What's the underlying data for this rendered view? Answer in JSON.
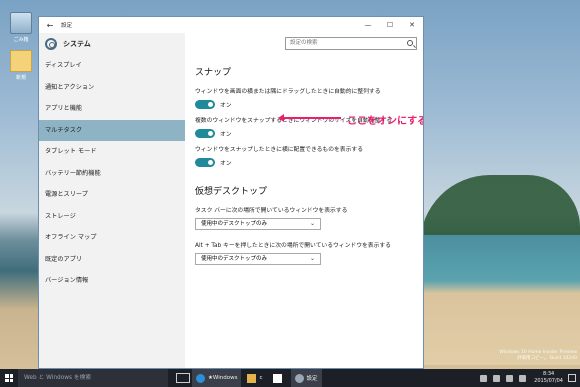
{
  "desktop": {
    "icons": [
      {
        "label": "ごみ箱"
      },
      {
        "label": "新規"
      }
    ],
    "watermark_lines": [
      "Windows 10 Home Insider Preview",
      "評価用コピー。 Build 10240"
    ]
  },
  "window": {
    "back_glyph": "←",
    "title": "設定",
    "controls": {
      "minimize": "—",
      "maximize": "☐",
      "close": "✕"
    }
  },
  "sidebar": {
    "title": "システム",
    "items": [
      {
        "label": "ディスプレイ"
      },
      {
        "label": "通知とアクション"
      },
      {
        "label": "アプリと機能"
      },
      {
        "label": "マルチタスク",
        "active": true
      },
      {
        "label": "タブレット モード"
      },
      {
        "label": "バッテリー節約機能"
      },
      {
        "label": "電源とスリープ"
      },
      {
        "label": "ストレージ"
      },
      {
        "label": "オフライン マップ"
      },
      {
        "label": "既定のアプリ"
      },
      {
        "label": "バージョン情報"
      }
    ]
  },
  "search": {
    "placeholder": "設定の検索"
  },
  "snap": {
    "heading": "スナップ",
    "settings": [
      {
        "label": "ウィンドウを画面の横または隅にドラッグしたときに自動的に整列する",
        "toggle": "オン"
      },
      {
        "label": "複数のウィンドウをスナップするときにウィンドウのサイズを自動調整する",
        "toggle": "オン"
      },
      {
        "label": "ウィンドウをスナップしたときに横に配置できるものを表示する",
        "toggle": "オン"
      }
    ]
  },
  "virtual_desktops": {
    "heading": "仮想デスクトップ",
    "settings": [
      {
        "label": "タスク バーに次の場所で開いているウィンドウを表示する",
        "value": "使用中のデスクトップのみ"
      },
      {
        "label": "Alt + Tab キーを押したときに次の場所で開いているウィンドウを表示する",
        "value": "使用中のデスクトップのみ"
      }
    ]
  },
  "annotation": {
    "text": "ここをオンにする",
    "color": "#e8216f"
  },
  "taskbar": {
    "search_placeholder": "Web と Windows を検索",
    "apps": [
      {
        "label": "★Windows",
        "icon": "internet-explorer-icon"
      },
      {
        "label": "c",
        "icon": "file-explorer-icon"
      },
      {
        "label": "",
        "icon": "store-icon"
      },
      {
        "label": "設定",
        "icon": "settings-icon"
      }
    ],
    "time": "8:34",
    "date": "2015/07/04"
  },
  "colors": {
    "accent": "#1e8a9a",
    "sidebar_active": "#8db3c5",
    "taskbar": "#1c1f26"
  }
}
